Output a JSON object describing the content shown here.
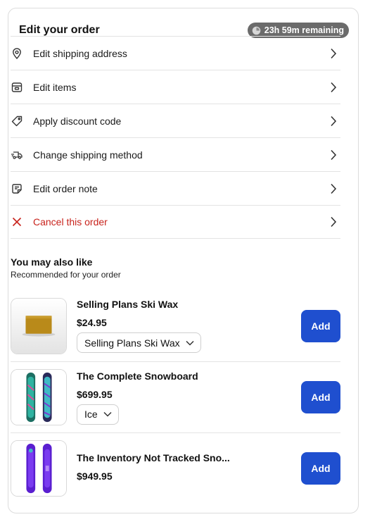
{
  "header": {
    "title": "Edit your order",
    "timer": "23h 59m remaining"
  },
  "menu": [
    {
      "label": "Edit shipping address",
      "icon": "location-pin-icon"
    },
    {
      "label": "Edit items",
      "icon": "box-icon"
    },
    {
      "label": "Apply discount code",
      "icon": "tag-icon"
    },
    {
      "label": "Change shipping method",
      "icon": "truck-icon"
    },
    {
      "label": "Edit order note",
      "icon": "note-icon"
    },
    {
      "label": "Cancel this order",
      "icon": "close-icon",
      "color": "#c8231c"
    }
  ],
  "recommendations": {
    "title": "You may also like",
    "subtitle": "Recommended for your order",
    "items": [
      {
        "name": "Selling Plans Ski Wax",
        "price": "$24.95",
        "variant": "Selling Plans Ski Wax",
        "add_label": "Add"
      },
      {
        "name": "The Complete Snowboard",
        "price": "$699.95",
        "variant": "Ice",
        "add_label": "Add"
      },
      {
        "name": "The Inventory Not Tracked Sno...",
        "price": "$949.95",
        "add_label": "Add"
      }
    ]
  },
  "colors": {
    "primary_button": "#1f4fcf",
    "danger": "#c8231c",
    "timer_badge": "#6b6b6b"
  }
}
